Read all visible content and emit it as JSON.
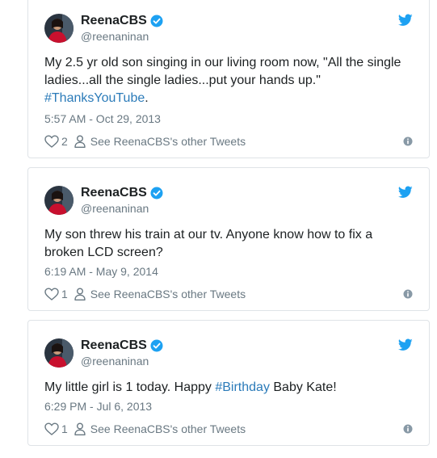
{
  "tweets": [
    {
      "display_name": "ReenaCBS",
      "handle": "@reenaninan",
      "text_before": "My 2.5 yr old son singing in our living room now, \"All the single ladies...all the single ladies...put your hands up.\" ",
      "hashtag": "#ThanksYouTube",
      "text_after": ".",
      "timestamp": "5:57 AM - Oct 29, 2013",
      "like_count": "2",
      "others_label": "See ReenaCBS's other Tweets"
    },
    {
      "display_name": "ReenaCBS",
      "handle": "@reenaninan",
      "text_before": "My son threw his train at our tv. Anyone know how to fix a broken LCD screen?",
      "hashtag": "",
      "text_after": "",
      "timestamp": "6:19 AM - May 9, 2014",
      "like_count": "1",
      "others_label": "See ReenaCBS's other Tweets"
    },
    {
      "display_name": "ReenaCBS",
      "handle": "@reenaninan",
      "text_before": "My little girl is 1 today. Happy ",
      "hashtag": "#Birthday",
      "text_after": " Baby Kate!",
      "timestamp": "6:29 PM - Jul 6, 2013",
      "like_count": "1",
      "others_label": "See ReenaCBS's other Tweets"
    }
  ],
  "icons": {
    "bird": "twitter-bird-icon",
    "verified": "verified-badge-icon",
    "like": "heart-icon",
    "person": "person-icon",
    "info": "info-icon"
  },
  "colors": {
    "twitter_blue": "#1da1f2",
    "hashtag": "#2b7bb9",
    "secondary_text": "#697882",
    "border": "#dfe3e7"
  }
}
